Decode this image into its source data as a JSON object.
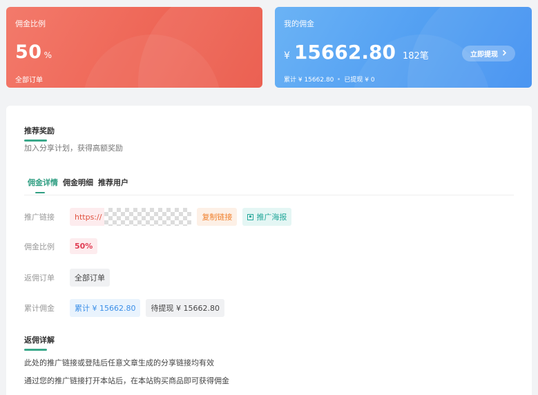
{
  "rate_card": {
    "title": "佣金比例",
    "rate": "50",
    "unit": "%",
    "subtitle": "全部订单"
  },
  "commission_card": {
    "title": "我的佣金",
    "currency": "¥",
    "amount": "15662.80",
    "count": "182笔",
    "total": "累计 ¥ 15662.80",
    "withdrawn": "已提现 ¥ 0",
    "withdraw_button": "立即提现",
    "withdraw_icon": "chevron-right-icon"
  },
  "section": {
    "title": "推荐奖励",
    "subtitle": "加入分享计划，获得高额奖励"
  },
  "tabs": [
    {
      "label": "佣金详情",
      "active": true
    },
    {
      "label": "佣金明细",
      "active": false
    },
    {
      "label": "推荐用户",
      "active": false
    }
  ],
  "details": {
    "promo_link_label": "推广链接",
    "promo_link_value": "https://",
    "copy_link": "复制链接",
    "poster": "推广海报",
    "rate_label": "佣金比例",
    "rate_value": "50%",
    "orders_label": "返佣订单",
    "orders_value": "全部订单",
    "total_label": "累计佣金",
    "total_value": "累计 ¥ 15662.80",
    "pending_value": "待提现 ¥ 15662.80"
  },
  "rules": {
    "title": "返佣详解",
    "lines": [
      "此处的推广链接或登陆后任意文章生成的分享链接均有效",
      "通过您的推广链接打开本站后，在本站购买商品即可获得佣金"
    ]
  },
  "colors": {
    "rate_card_start": "#f37a6b",
    "rate_card_end": "#ea5545",
    "commission_card_start": "#6bb3f5",
    "commission_card_end": "#3d8ef0",
    "accent": "#2f9e82"
  }
}
